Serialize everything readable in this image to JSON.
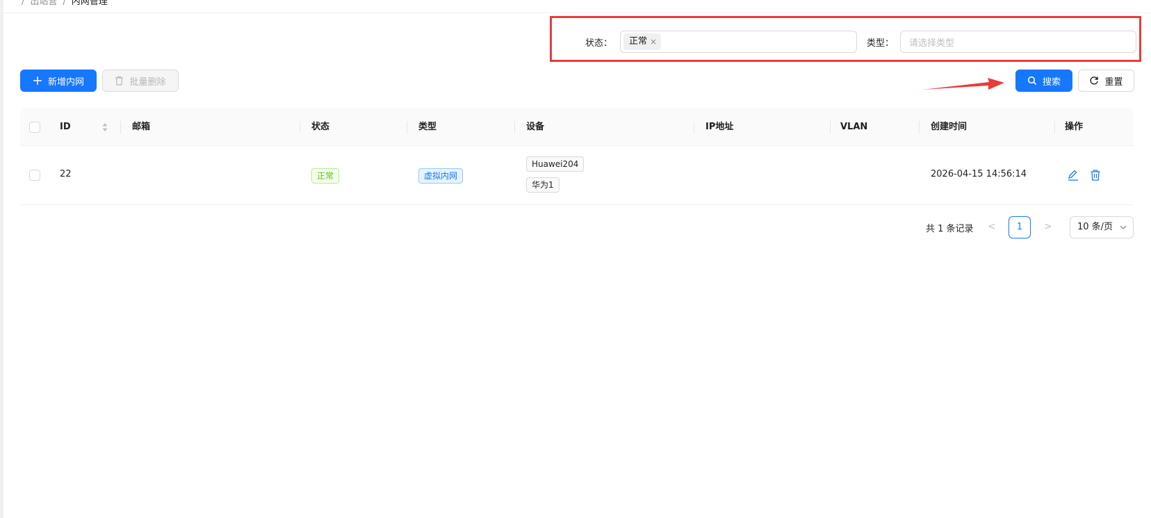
{
  "breadcrumb": {
    "parent": "出站营",
    "current": "内网管理"
  },
  "filters": {
    "status_label": "状态：",
    "status_tag": "正常",
    "type_label": "类型：",
    "type_placeholder": "请选择类型"
  },
  "toolbar": {
    "add_label": "新增内网",
    "batch_delete_label": "批量删除",
    "search_label": "搜索",
    "reset_label": "重置"
  },
  "table": {
    "columns": [
      "ID",
      "邮箱",
      "状态",
      "类型",
      "设备",
      "IP地址",
      "VLAN",
      "创建时间",
      "操作"
    ],
    "rows": [
      {
        "id": "22",
        "email": "",
        "status": "正常",
        "type": "虚拟内网",
        "devices": [
          "Huawei204",
          "华为1"
        ],
        "ip": "",
        "vlan": "",
        "created": "2026-04-15 14:56:14"
      }
    ]
  },
  "pagination": {
    "total": "共 1 条记录",
    "current_page": "1",
    "page_size": "10 条/页"
  },
  "colors": {
    "primary": "#1677ff",
    "highlight": "#ea3b3b",
    "success": "#52c41a"
  }
}
